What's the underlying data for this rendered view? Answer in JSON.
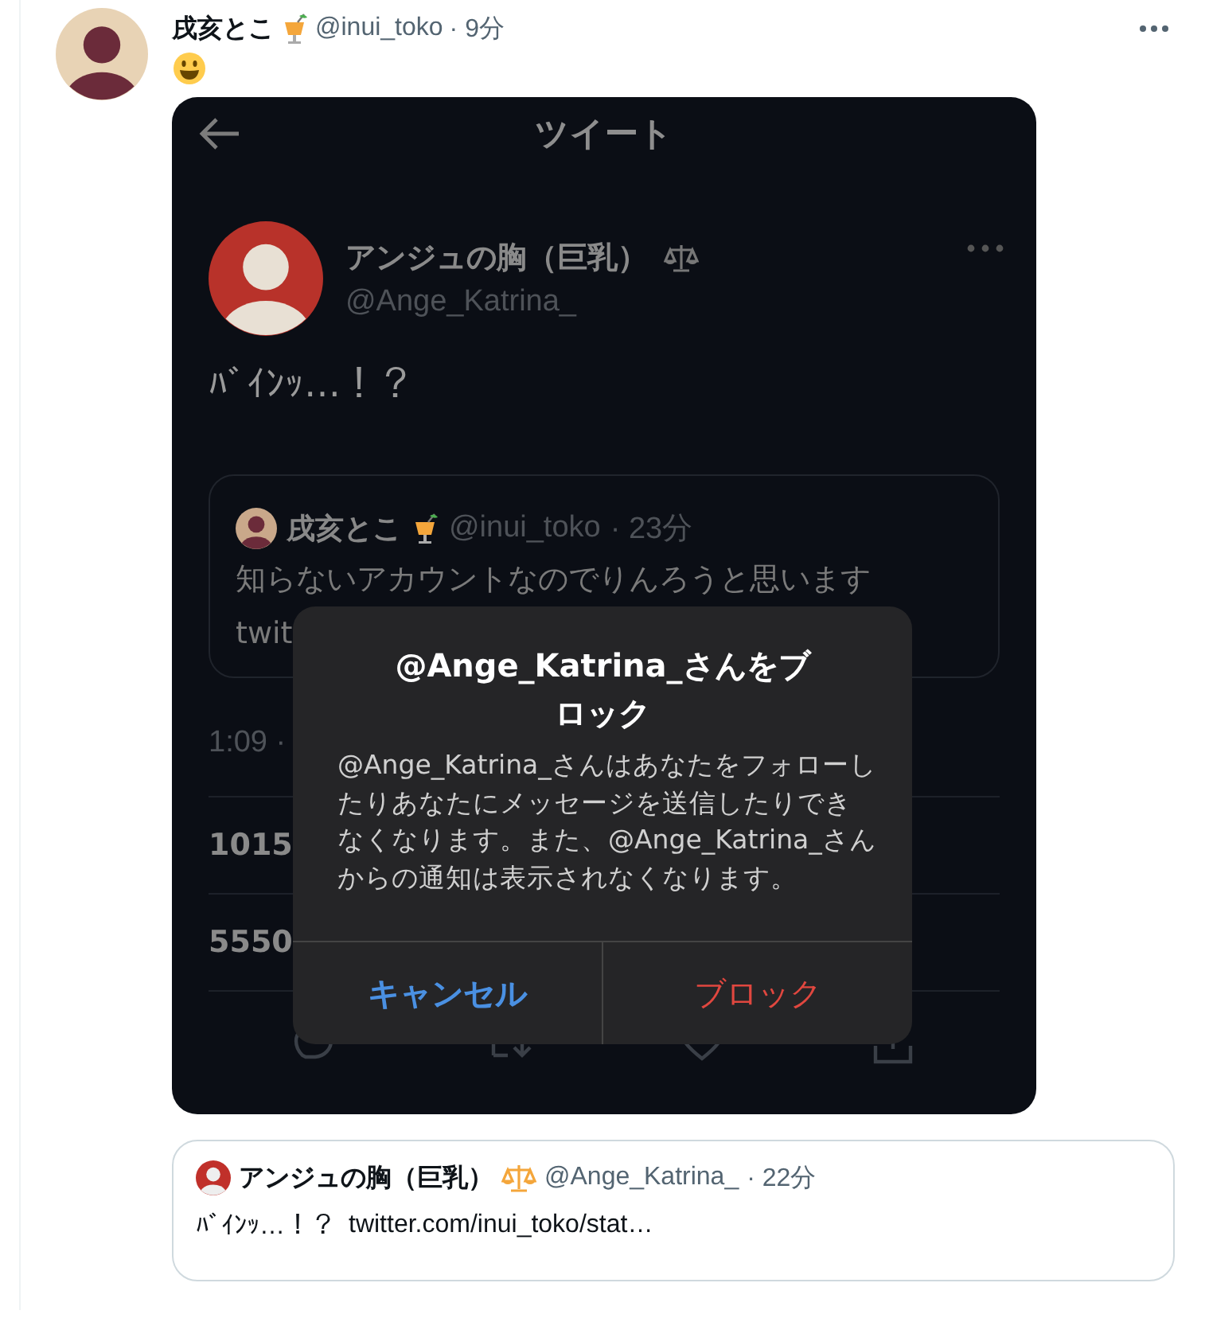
{
  "tweet": {
    "author": {
      "name": "戌亥とこ",
      "handle": "@inui_toko",
      "time": "· 9分"
    },
    "image": {
      "header": {
        "title": "ツイート"
      },
      "tweet": {
        "name": "アンジュの胸（巨乳）",
        "handle": "@Ange_Katrina_",
        "text": "ﾊﾞｲﾝｯ…！？",
        "quote": {
          "name": "戌亥とこ",
          "handle": "@inui_toko",
          "time": "· 23分",
          "lines": [
            "知らないアカウントなのでりんろうと思います",
            "twit"
          ]
        },
        "timestamp": "1:09 ·",
        "stats": [
          "1015",
          "5550"
        ]
      },
      "dialog": {
        "title": "@Ange_Katrina_さんをブロック",
        "message": "@Ange_Katrina_さんはあなたをフォローしたりあなたにメッセージを送信したりできなくなります。また、@Ange_Katrina_さんからの通知は表示されなくなります。",
        "buttons": [
          {
            "label": "キャンセル",
            "kind": "cancel"
          },
          {
            "label": "ブロック",
            "kind": "destructive"
          }
        ]
      }
    },
    "quote": {
      "name": "アンジュの胸（巨乳）",
      "handle": "@Ange_Katrina_",
      "time": "· 22分",
      "text": "ﾊﾞｲﾝｯ…！？",
      "link": "twitter.com/inui_toko/stat…"
    }
  }
}
